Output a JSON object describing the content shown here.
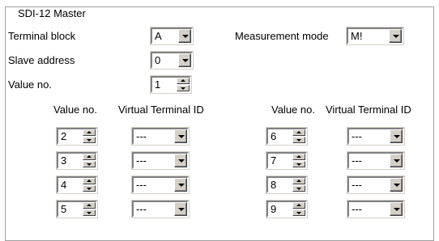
{
  "group_title": "SDI-12 Master",
  "terminal_block": {
    "label": "Terminal block",
    "value": "A"
  },
  "measurement_mode": {
    "label": "Measurement mode",
    "value": "M!"
  },
  "slave_address": {
    "label": "Slave address",
    "value": "0"
  },
  "value_no": {
    "label": "Value no.",
    "value": "1"
  },
  "table": {
    "col_value_no": "Value no.",
    "col_virtual_terminal_id": "Virtual Terminal ID",
    "left_rows": [
      {
        "value_no": "2",
        "vt_id": "---"
      },
      {
        "value_no": "3",
        "vt_id": "---"
      },
      {
        "value_no": "4",
        "vt_id": "---"
      },
      {
        "value_no": "5",
        "vt_id": "---"
      }
    ],
    "right_rows": [
      {
        "value_no": "6",
        "vt_id": "---"
      },
      {
        "value_no": "7",
        "vt_id": "---"
      },
      {
        "value_no": "8",
        "vt_id": "---"
      },
      {
        "value_no": "9",
        "vt_id": "---"
      }
    ]
  }
}
